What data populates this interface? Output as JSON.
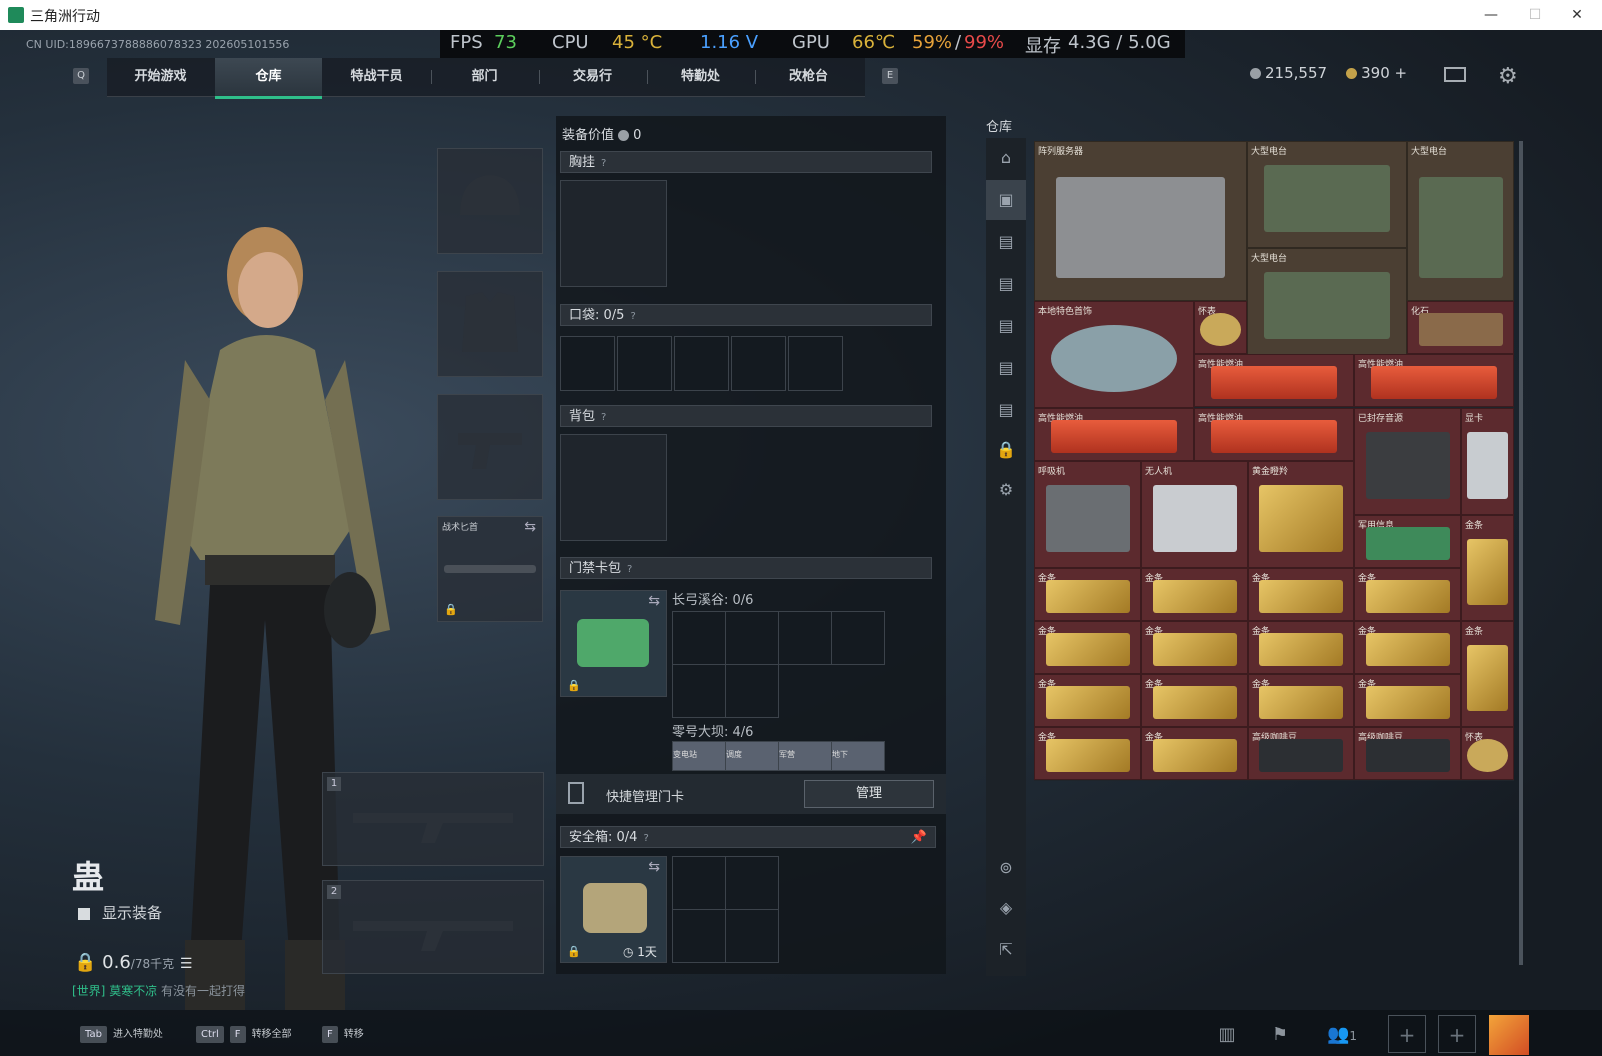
{
  "window": {
    "title": "三角洲行动"
  },
  "hud": {
    "fps_label": "FPS",
    "fps": "73",
    "cpu_label": "CPU",
    "cpu_temp": "45 °C",
    "voltage": "1.16 V",
    "gpu_label": "GPU",
    "gpu_temp": "66℃",
    "gpu_usage": "59%",
    "gpu_sep": "/",
    "gpu_load": "99%",
    "vram_label": "显存",
    "vram": "4.3G / 5.0G"
  },
  "uid": "CN UID:1896673788886078323 202605101556",
  "nav": {
    "key_left": "Q",
    "key_right": "E",
    "tabs": [
      "开始游戏",
      "仓库",
      "特战干员",
      "部门",
      "交易行",
      "特勤处",
      "改枪台"
    ],
    "active": "仓库"
  },
  "currency": {
    "silver": "215,557",
    "gold": "390",
    "plus": "+"
  },
  "character": {
    "name": "蛊",
    "show_equipment": "显示装备",
    "weight": "0.6",
    "weight_max": "/78千克"
  },
  "chat": {
    "channel": "[世界]",
    "user": "莫寒不凉",
    "message": "有没有一起打得"
  },
  "slots": {
    "knife_label": "战术匕首",
    "slot1": "1",
    "slot2": "2"
  },
  "center": {
    "equip_value_label": "装备价值",
    "equip_value": "0",
    "vest_label": "胸挂",
    "pocket_label": "口袋:",
    "pocket_count": "0/5",
    "backpack_label": "背包",
    "keycard_label": "门禁卡包",
    "keycard_map1": "长弓溪谷: 0/6",
    "keycard_map2": "零号大坝: 4/6",
    "map2_cards": [
      "变电站",
      "调度",
      "军营",
      "地下"
    ],
    "quick_manage": "快捷管理门卡",
    "manage_button": "管理",
    "safe_label": "安全箱:",
    "safe_count": "0/4",
    "safe_timer": "1天",
    "qmark": "?"
  },
  "warehouse": {
    "title": "仓库",
    "items": [
      "阵列服务器",
      "大型电台",
      "大型电台",
      "大型电台",
      "本地特色首饰",
      "怀表",
      "化石",
      "高性能燃油",
      "高性能燃油",
      "高性能燃油",
      "高性能燃油",
      "已封存音源",
      "显卡",
      "呼吸机",
      "无人机",
      "黄金瞪羚",
      "军用信息",
      "金条",
      "高级咖啡豆",
      "高级咖啡豆",
      "怀表"
    ]
  },
  "bottom": {
    "tab_key": "Tab",
    "tab_label": "进入特勤处",
    "ctrl_key": "Ctrl",
    "f_key": "F",
    "transfer_all": "转移全部",
    "transfer": "转移",
    "friends": "1"
  }
}
